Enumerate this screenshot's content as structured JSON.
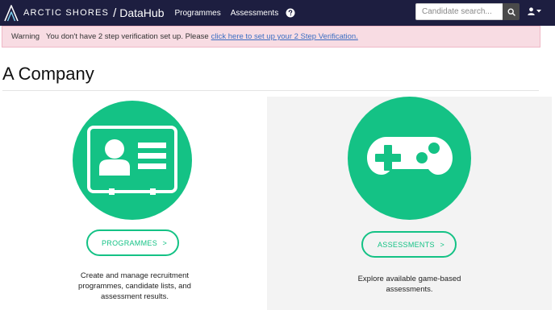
{
  "header": {
    "brand_name": "ARCTIC SHORES",
    "separator": "/",
    "product_name": "DataHub",
    "nav": [
      {
        "label": "Programmes"
      },
      {
        "label": "Assessments"
      }
    ],
    "help_icon": "question-circle-icon",
    "search": {
      "placeholder": "Candidate search...",
      "value": ""
    },
    "search_icon": "search-icon",
    "user_icon": "user-icon"
  },
  "alert": {
    "label": "Warning",
    "message": "You don't have 2 step verification set up. Please",
    "link": "click here to set up your 2 Step Verification."
  },
  "page": {
    "title": "A Company"
  },
  "cards": [
    {
      "icon": "id-card-icon",
      "button_label": "PROGRAMMES",
      "button_arrow": ">",
      "description": "Create and manage recruitment programmes, candidate lists, and assessment results."
    },
    {
      "icon": "gamepad-icon",
      "button_label": "ASSESSMENTS",
      "button_arrow": ">",
      "description": "Explore available game-based assessments."
    }
  ],
  "colors": {
    "navbar_bg": "#1d1e40",
    "accent_green": "#14c285",
    "alert_bg": "#f8dce3",
    "alert_link": "#3b6ec2"
  }
}
